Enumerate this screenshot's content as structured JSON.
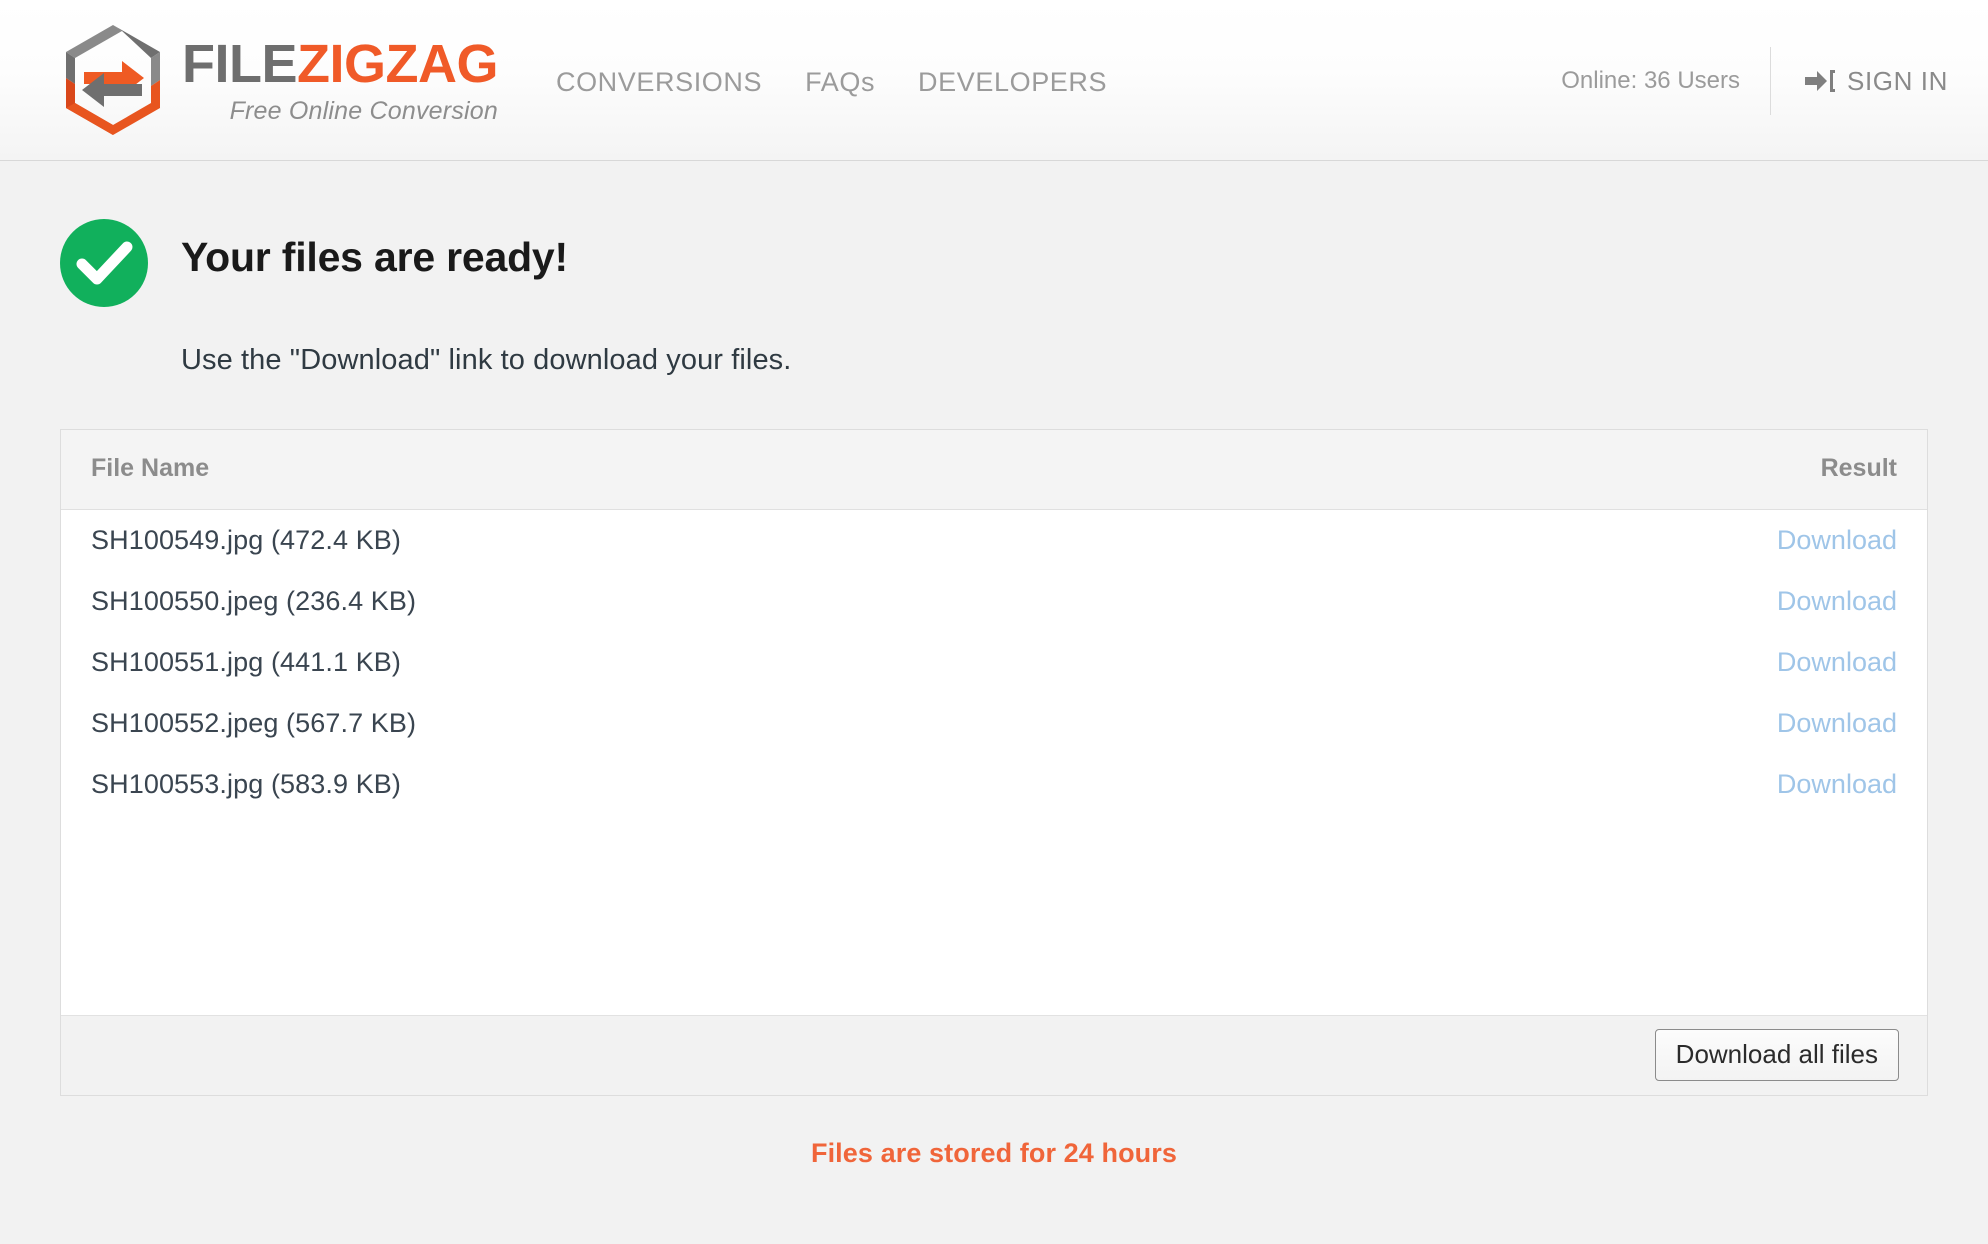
{
  "header": {
    "logo_icon": "filezigzag-hexagon-recycle-logo",
    "brand_part1": "FILE",
    "brand_part2": "ZIGZAG",
    "tagline": "Free Online Conversion",
    "nav": [
      {
        "label": "CONVERSIONS",
        "name": "nav-conversions"
      },
      {
        "label": "FAQs",
        "name": "nav-faqs"
      },
      {
        "label": "DEVELOPERS",
        "name": "nav-developers"
      }
    ],
    "online_users": "Online: 36 Users",
    "signin_label": "SIGN IN",
    "signin_icon": "sign-in-arrow-icon"
  },
  "status": {
    "icon": "green-check-circle-icon",
    "heading": "Your files are ready!",
    "subtitle": "Use the \"Download\" link to download your files."
  },
  "table": {
    "columns": {
      "name": "File Name",
      "result": "Result"
    },
    "rows": [
      {
        "file": "SH100549.jpg (472.4 KB)",
        "action": "Download"
      },
      {
        "file": "SH100550.jpeg (236.4 KB)",
        "action": "Download"
      },
      {
        "file": "SH100551.jpg (441.1 KB)",
        "action": "Download"
      },
      {
        "file": "SH100552.jpeg (567.7 KB)",
        "action": "Download"
      },
      {
        "file": "SH100553.jpg (583.9 KB)",
        "action": "Download"
      }
    ]
  },
  "footer": {
    "download_all_label": "Download all files",
    "storage_note": "Files are stored for 24 hours"
  },
  "colors": {
    "brand_orange": "#f05a28",
    "brand_gray": "#6e6e6e",
    "success_green": "#11b05c",
    "link_blue": "#9fc5e8",
    "note_orange": "#f0653a"
  }
}
